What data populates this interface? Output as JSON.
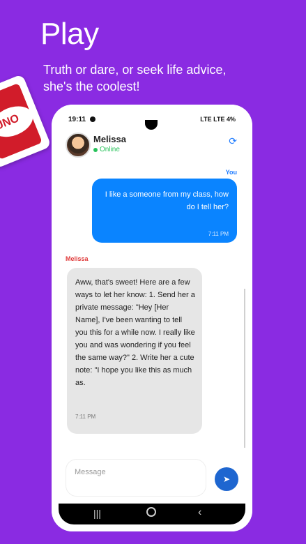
{
  "promo": {
    "title": "Play",
    "subtitle": "Truth or dare, or seek life advice, she's the coolest!",
    "card_text": "UNO"
  },
  "status": {
    "time": "19:11",
    "battery": "4%",
    "signals": "LTE LTE"
  },
  "header": {
    "name": "Melissa",
    "status": "Online"
  },
  "chat": {
    "you_label": "You",
    "outgoing": {
      "text": "I like a someone from my class, how do I tell her?",
      "time": "7:11 PM"
    },
    "incoming_label": "Melissa",
    "incoming": {
      "text": "Aww, that's sweet! Here are a few ways to let her know: 1. Send her a private message: \"Hey [Her Name], I've been wanting to tell you this for a while now. I really like you and was wondering if you feel the same way?\" 2. Write her a cute note: \"I hope you like this as much as.",
      "time": "7:11 PM"
    }
  },
  "composer": {
    "placeholder": "Message"
  },
  "colors": {
    "background": "#8a2be2",
    "outgoing_bubble": "#0a84ff",
    "incoming_bubble": "#e6e6e6",
    "online": "#27c25a",
    "send_button": "#1e66d0"
  },
  "icons": {
    "refresh": "refresh-icon",
    "send": "send-icon",
    "nav_recents": "recents-icon",
    "nav_home": "home-icon",
    "nav_back": "back-icon"
  }
}
